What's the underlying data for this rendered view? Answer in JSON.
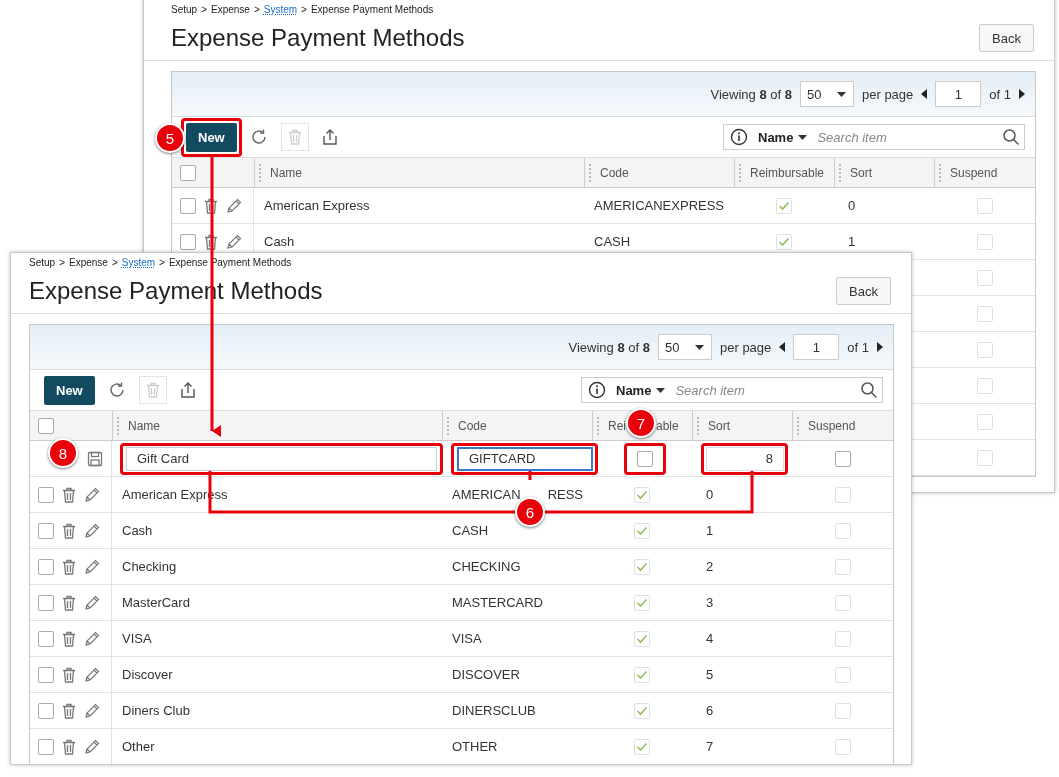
{
  "windows": [
    {
      "breadcrumb": [
        {
          "text": "Setup",
          "link": false
        },
        {
          "text": "Expense",
          "link": false
        },
        {
          "text": "System",
          "link": true
        },
        {
          "text": "Expense Payment Methods",
          "link": false
        }
      ],
      "breadcrumb_separator": ">",
      "title": "Expense Payment Methods",
      "back_button": "Back",
      "pager": {
        "viewing": "Viewing **8** of **8**",
        "page_size": "50",
        "per_page": "per page",
        "page": "1",
        "page_count": "of 1"
      },
      "toolbar": {
        "new_button": "New",
        "delete_disabled": true
      },
      "search": {
        "field": "Name",
        "placeholder": "Search item"
      },
      "all_selected": false,
      "columns": [
        {
          "label": "Name"
        },
        {
          "label": "Code"
        },
        {
          "label": "Reimbursable"
        },
        {
          "label": "Sort"
        },
        {
          "label": "Suspend"
        }
      ],
      "rows": [
        {
          "checked": false,
          "name": "American Express",
          "code": "AMERICANEXPRESS",
          "reimbursable": true,
          "sort": "0",
          "suspended": false
        },
        {
          "checked": false,
          "name": "Cash",
          "code": "CASH",
          "reimbursable": true,
          "sort": "1",
          "suspended": false
        },
        {
          "suspended": false
        },
        {
          "suspended": false
        },
        {
          "suspended": false
        },
        {
          "suspended": false
        },
        {
          "suspended": false
        },
        {
          "suspended": false
        }
      ]
    },
    {
      "breadcrumb": [
        {
          "text": "Setup",
          "link": false
        },
        {
          "text": "Expense",
          "link": false
        },
        {
          "text": "System",
          "link": true
        },
        {
          "text": "Expense Payment Methods",
          "link": false
        }
      ],
      "breadcrumb_separator": ">",
      "title": "Expense Payment Methods",
      "back_button": "Back",
      "pager": {
        "viewing": "Viewing **8** of **8**",
        "page_size": "50",
        "per_page": "per page",
        "page": "1",
        "page_count": "of 1"
      },
      "toolbar": {
        "new_button": "New",
        "delete_disabled": true
      },
      "search": {
        "field": "Name",
        "placeholder": "Search item"
      },
      "all_selected": false,
      "columns": [
        {
          "label": "Name"
        },
        {
          "label": "Code"
        },
        {
          "label": "Rei",
          "label_after": "able"
        },
        {
          "label": "Sort"
        },
        {
          "label": "Suspend"
        }
      ],
      "new_row": {
        "name": "Gift Card",
        "code": "GIFTCARD",
        "code_focused": true,
        "reimbursable": false,
        "sort": "8",
        "suspended": false
      },
      "rows": [
        {
          "checked": false,
          "name": "American Express",
          "code": "AMERICAN",
          "code_after": "RESS",
          "reimbursable": true,
          "sort": "0",
          "suspended": false
        },
        {
          "checked": false,
          "name": "Cash",
          "code": "CASH",
          "reimbursable": true,
          "sort": "1",
          "suspended": false
        },
        {
          "checked": false,
          "name": "Checking",
          "code": "CHECKING",
          "reimbursable": true,
          "sort": "2",
          "suspended": false
        },
        {
          "checked": false,
          "name": "MasterCard",
          "code": "MASTERCARD",
          "reimbursable": true,
          "sort": "3",
          "suspended": false
        },
        {
          "checked": false,
          "name": "VISA",
          "code": "VISA",
          "reimbursable": true,
          "sort": "4",
          "suspended": false
        },
        {
          "checked": false,
          "name": "Discover",
          "code": "DISCOVER",
          "reimbursable": true,
          "sort": "5",
          "suspended": false
        },
        {
          "checked": false,
          "name": "Diners Club",
          "code": "DINERSCLUB",
          "reimbursable": true,
          "sort": "6",
          "suspended": false
        },
        {
          "checked": false,
          "name": "Other",
          "code": "OTHER",
          "reimbursable": true,
          "sort": "7",
          "suspended": false
        }
      ]
    }
  ],
  "callouts": [
    {
      "label": "5"
    },
    {
      "label": "6"
    },
    {
      "label": "7"
    },
    {
      "label": "8"
    }
  ]
}
